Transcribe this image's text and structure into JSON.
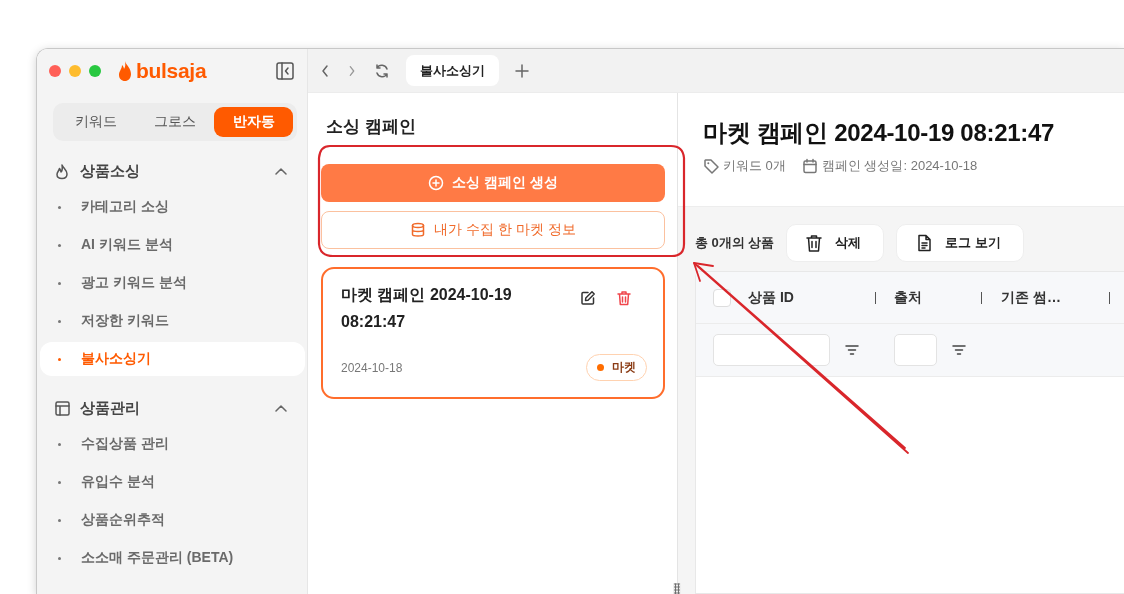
{
  "window": {
    "tab": {
      "label": "불사소싱기",
      "selected": true
    }
  },
  "sidebar": {
    "logo": "bulsaja",
    "modes": [
      {
        "label": "키워드",
        "selected": false
      },
      {
        "label": "그로스",
        "selected": false
      },
      {
        "label": "반자동",
        "selected": true
      }
    ],
    "sections": [
      {
        "kind": "sourcing",
        "title": "상품소싱",
        "expanded": true,
        "items": [
          {
            "label": "카테고리 소싱",
            "selected": false
          },
          {
            "label": "AI 키워드 분석",
            "selected": false
          },
          {
            "label": "광고 키워드 분석",
            "selected": false
          },
          {
            "label": "저장한 키워드",
            "selected": false
          },
          {
            "label": "불사소싱기",
            "selected": true
          }
        ]
      },
      {
        "kind": "management",
        "title": "상품관리",
        "expanded": true,
        "items": [
          {
            "label": "수집상품 관리",
            "selected": false
          },
          {
            "label": "유입수 분석",
            "selected": false
          },
          {
            "label": "상품순위추적",
            "selected": false
          },
          {
            "label": "소소매 주문관리 (BETA)",
            "selected": false
          }
        ]
      }
    ]
  },
  "campaign_panel": {
    "title": "소싱 캠페인",
    "buttons": [
      {
        "kind": "primary",
        "label": "소싱 캠페인 생성"
      },
      {
        "kind": "outline",
        "label": "내가 수집 한 마켓 정보"
      }
    ],
    "campaigns": [
      {
        "title": "마켓 캠페인 2024-10-19 08:21:47",
        "date": "2024-10-18",
        "tag": "마켓",
        "selected": true
      }
    ]
  },
  "detail": {
    "title": "마켓 캠페인 2024-10-19 08:21:47",
    "meta": [
      {
        "kind": "keyword",
        "text": "키워드 0개"
      },
      {
        "kind": "date",
        "text": "캠페인 생성일: 2024-10-18"
      }
    ],
    "count": "총 0개의 상품",
    "actions": [
      {
        "kind": "delete",
        "label": "삭제"
      },
      {
        "kind": "log",
        "label": "로그 보기"
      }
    ],
    "table": {
      "select_all": {
        "checked": false
      },
      "columns": [
        {
          "label": "상품 ID",
          "kind": "wide"
        },
        {
          "label": "출처",
          "kind": "narrow"
        },
        {
          "label": "기존 썸…",
          "kind": "plain"
        }
      ]
    }
  }
}
